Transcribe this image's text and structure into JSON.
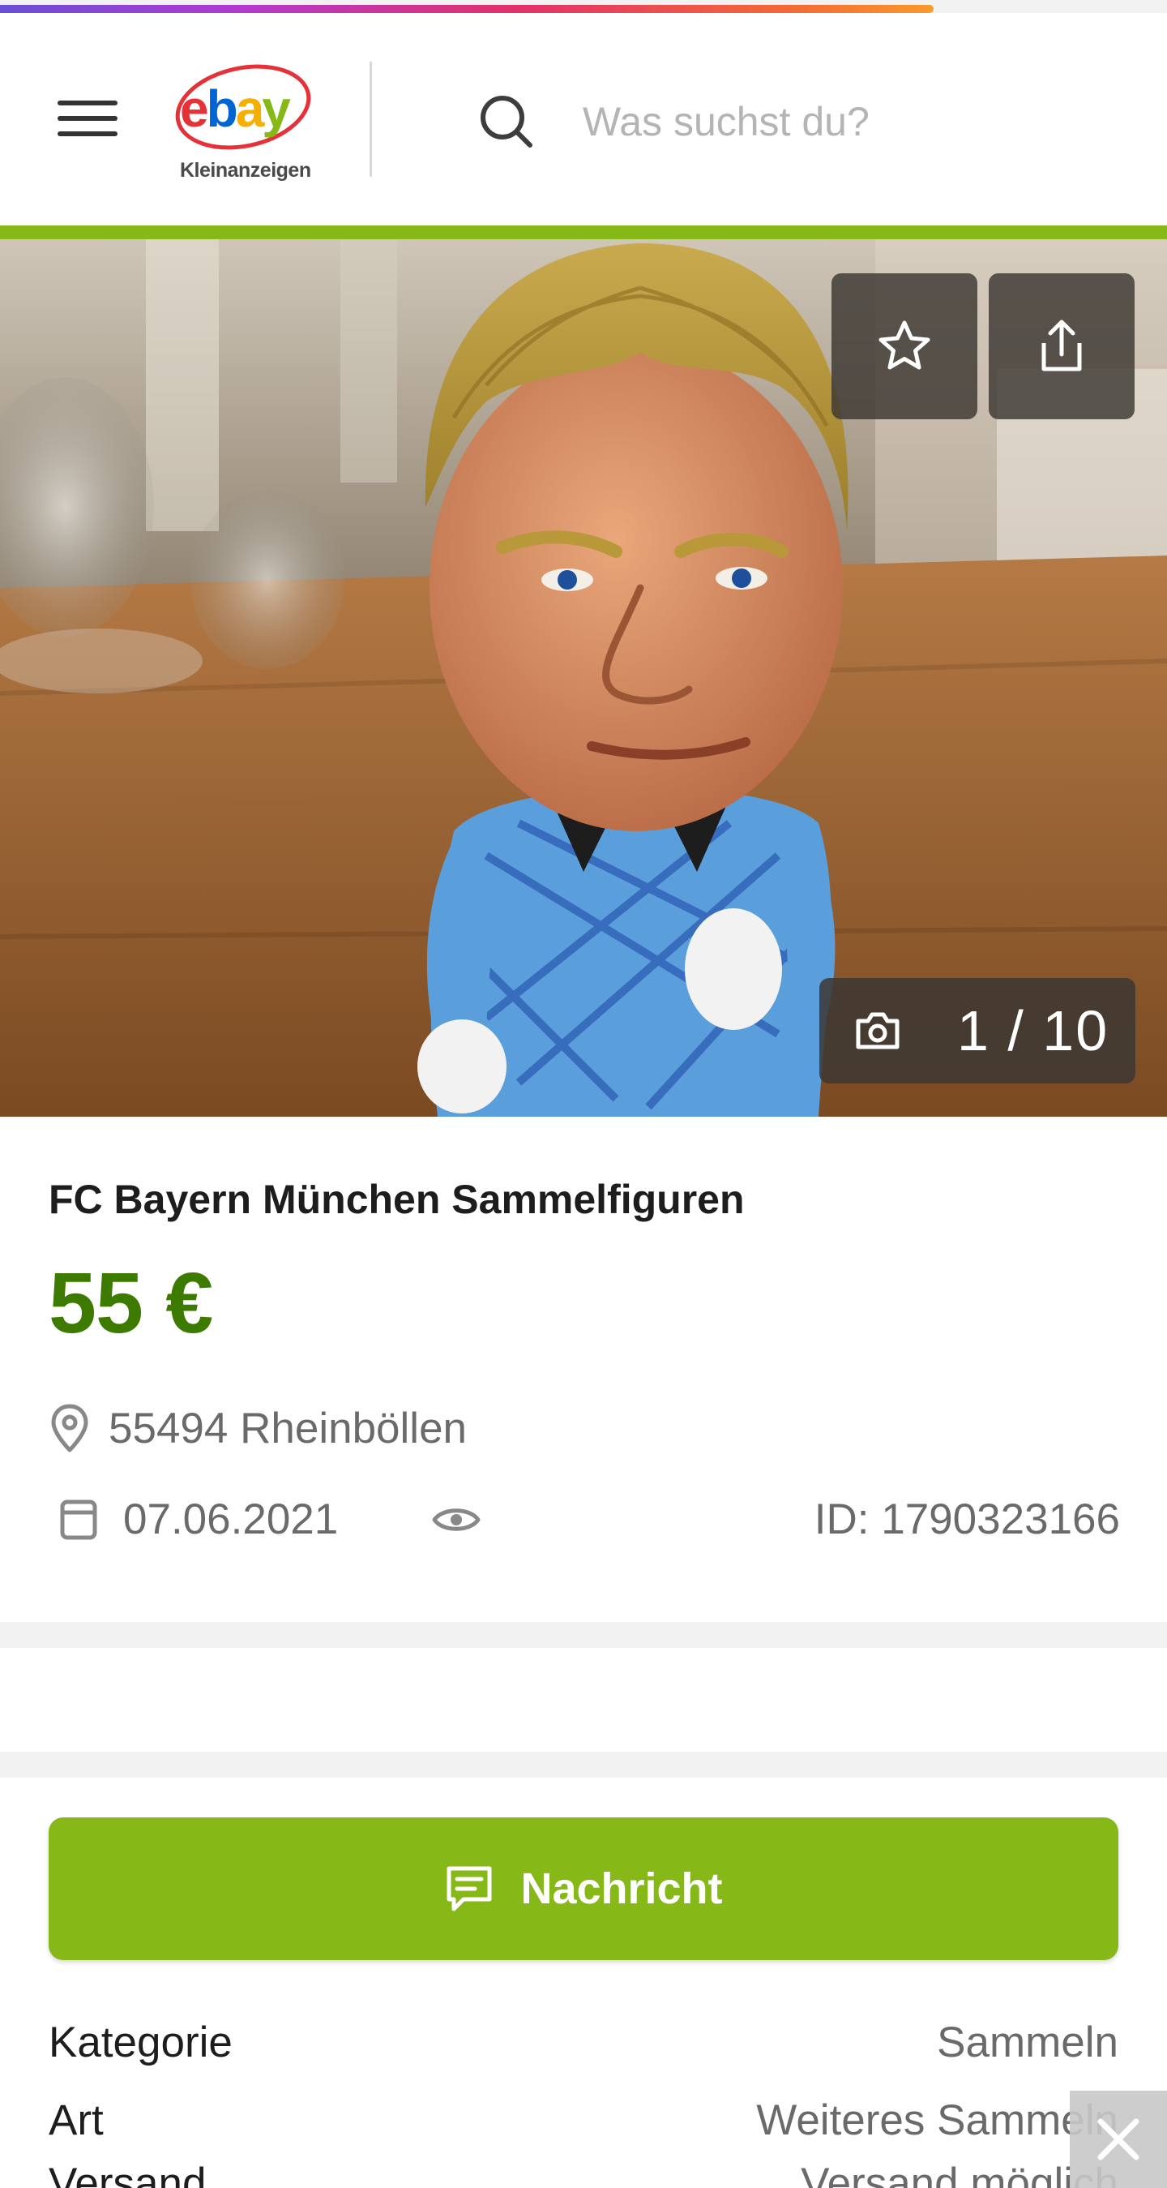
{
  "loading": {
    "progress_percent": 80
  },
  "header": {
    "logo_main": "ebay",
    "logo_sub": "Kleinanzeigen",
    "search_placeholder": "Was suchst du?",
    "accent_color": "#86b817"
  },
  "gallery": {
    "counter": "1 / 10",
    "current": 1,
    "total": 10
  },
  "listing": {
    "title": "FC Bayern München Sammelfiguren",
    "price": "55 €",
    "location": "55494 Rheinböllen",
    "date": "07.06.2021",
    "id": "ID: 1790323166",
    "price_color": "#3d7a00"
  },
  "actions": {
    "message_label": "Nachricht"
  },
  "attributes": [
    {
      "key": "Kategorie",
      "value": "Sammeln"
    },
    {
      "key": "Art",
      "value": "Weiteres Sammeln"
    },
    {
      "key": "Versand",
      "value": "Versand möglich"
    }
  ],
  "icons": [
    "menu-icon",
    "search-icon",
    "star-icon",
    "share-icon",
    "camera-icon",
    "location-pin-icon",
    "calendar-icon",
    "eye-icon",
    "message-icon",
    "close-icon"
  ]
}
